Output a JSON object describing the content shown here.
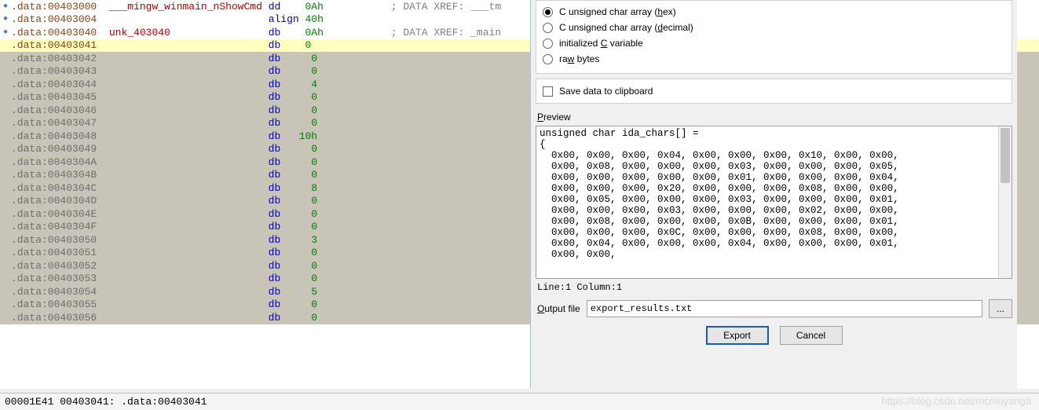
{
  "disasm": {
    "header_rows": [
      {
        "bullet": true,
        "addr": ".data:00403000",
        "name": "___mingw_winmain_nShowCmd",
        "op": "dd",
        "val": "0Ah",
        "xref": "; DATA XREF: ___tm"
      },
      {
        "bullet": true,
        "addr": ".data:00403004",
        "name": "",
        "op": "align",
        "val": "40h",
        "xref": ""
      },
      {
        "bullet": true,
        "addr": ".data:00403040",
        "name": "unk_403040",
        "op": "db",
        "val": "0Ah",
        "xref": "; DATA XREF: _main"
      }
    ],
    "selected": {
      "addr": ".data:00403041",
      "op": "db",
      "val": "0"
    },
    "shaded_rows": [
      {
        "addr": ".data:00403042",
        "val": "0"
      },
      {
        "addr": ".data:00403043",
        "val": "0"
      },
      {
        "addr": ".data:00403044",
        "val": "4"
      },
      {
        "addr": ".data:00403045",
        "val": "0"
      },
      {
        "addr": ".data:00403046",
        "val": "0"
      },
      {
        "addr": ".data:00403047",
        "val": "0"
      },
      {
        "addr": ".data:00403048",
        "val": "10h"
      },
      {
        "addr": ".data:00403049",
        "val": "0"
      },
      {
        "addr": ".data:0040304A",
        "val": "0"
      },
      {
        "addr": ".data:0040304B",
        "val": "0"
      },
      {
        "addr": ".data:0040304C",
        "val": "8"
      },
      {
        "addr": ".data:0040304D",
        "val": "0"
      },
      {
        "addr": ".data:0040304E",
        "val": "0"
      },
      {
        "addr": ".data:0040304F",
        "val": "0"
      },
      {
        "addr": ".data:00403050",
        "val": "3"
      },
      {
        "addr": ".data:00403051",
        "val": "0"
      },
      {
        "addr": ".data:00403052",
        "val": "0"
      },
      {
        "addr": ".data:00403053",
        "val": "0"
      },
      {
        "addr": ".data:00403054",
        "val": "5"
      },
      {
        "addr": ".data:00403055",
        "val": "0"
      },
      {
        "addr": ".data:00403056",
        "val": "0"
      }
    ]
  },
  "status": "00001E41 00403041: .data:00403041",
  "dialog": {
    "radios": [
      {
        "label_pre": "C unsigned char array (",
        "label_u": "h",
        "label_post": "ex)",
        "checked": true
      },
      {
        "label_pre": "C unsigned char array (",
        "label_u": "d",
        "label_post": "ecimal)",
        "checked": false
      },
      {
        "label_pre": "initialized ",
        "label_u": "C",
        "label_post": " variable",
        "checked": false
      },
      {
        "label_pre": "ra",
        "label_u": "w",
        "label_post": " bytes",
        "checked": false
      }
    ],
    "saveclip_label": "Save data to clipboard",
    "preview_label_pre": "",
    "preview_label_u": "P",
    "preview_label_post": "review",
    "preview_text": "unsigned char ida_chars[] =\n{\n  0x00, 0x00, 0x00, 0x04, 0x00, 0x00, 0x00, 0x10, 0x00, 0x00,\n  0x00, 0x08, 0x00, 0x00, 0x00, 0x03, 0x00, 0x00, 0x00, 0x05,\n  0x00, 0x00, 0x00, 0x00, 0x00, 0x01, 0x00, 0x00, 0x00, 0x04,\n  0x00, 0x00, 0x00, 0x20, 0x00, 0x00, 0x00, 0x08, 0x00, 0x00,\n  0x00, 0x05, 0x00, 0x00, 0x00, 0x03, 0x00, 0x00, 0x00, 0x01,\n  0x00, 0x00, 0x00, 0x03, 0x00, 0x00, 0x00, 0x02, 0x00, 0x00,\n  0x00, 0x08, 0x00, 0x00, 0x00, 0x0B, 0x00, 0x00, 0x00, 0x01,\n  0x00, 0x00, 0x00, 0x0C, 0x00, 0x00, 0x00, 0x08, 0x00, 0x00,\n  0x00, 0x04, 0x00, 0x00, 0x00, 0x04, 0x00, 0x00, 0x00, 0x01,\n  0x00, 0x00,",
    "linecol_pre": "Line:",
    "linecol_line": "1",
    "linecol_mid": "  Column:",
    "linecol_col": "1",
    "output_label_pre": "",
    "output_label_u": "O",
    "output_label_post": "utput file",
    "output_value": "export_results.txt",
    "browse_label": "...",
    "export_btn": "Export",
    "cancel_btn": "Cancel"
  },
  "watermark": "https://blog.csdn.net/mcmuyanga"
}
